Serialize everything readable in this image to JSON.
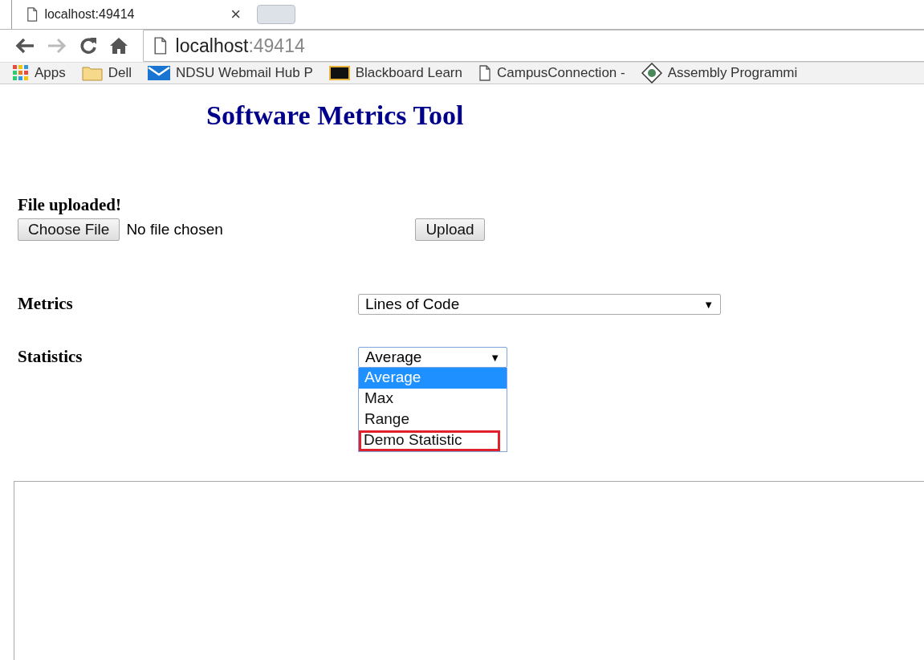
{
  "tab": {
    "title": "localhost:49414",
    "close": "×"
  },
  "address": {
    "host": "localhost",
    "port": ":49414"
  },
  "bookmarks": [
    {
      "kind": "apps",
      "label": "Apps"
    },
    {
      "kind": "folder",
      "label": "Dell"
    },
    {
      "kind": "mail",
      "label": "NDSU Webmail Hub P"
    },
    {
      "kind": "bb",
      "label": "Blackboard Learn"
    },
    {
      "kind": "page",
      "label": "CampusConnection -"
    },
    {
      "kind": "diamond",
      "label": "Assembly Programmi"
    }
  ],
  "page": {
    "title": "Software Metrics Tool",
    "status": "File uploaded!",
    "file_button": "Choose File",
    "file_name": "No file chosen",
    "upload_button": "Upload",
    "metrics": {
      "label": "Metrics",
      "value": "Lines of Code",
      "arrow": "▼"
    },
    "statistics": {
      "label": "Statistics",
      "value": "Average",
      "arrow": "▼",
      "expanded": true,
      "options": [
        {
          "label": "Average",
          "selected": true,
          "marked": false
        },
        {
          "label": "Max",
          "selected": false,
          "marked": false
        },
        {
          "label": "Range",
          "selected": false,
          "marked": false
        },
        {
          "label": "Demo Statistic",
          "selected": false,
          "marked": true
        }
      ]
    }
  }
}
